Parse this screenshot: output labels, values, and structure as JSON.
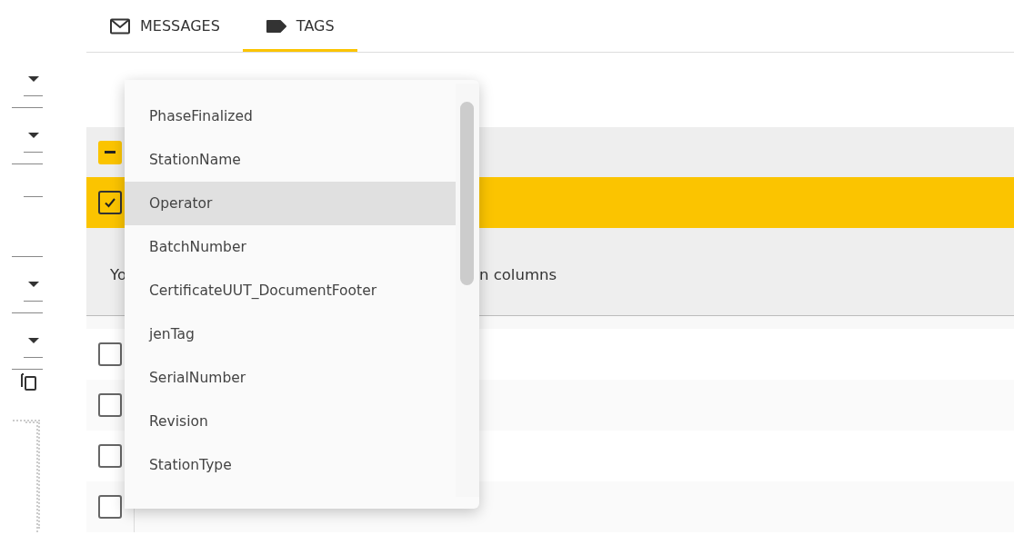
{
  "sidebar": {
    "controls": [
      {
        "kind": "dropdown"
      },
      {
        "kind": "dropdown"
      },
      {
        "kind": "field"
      },
      {
        "kind": "dropdown"
      },
      {
        "kind": "dropdown"
      },
      {
        "kind": "copy"
      },
      {
        "kind": "dotted"
      }
    ]
  },
  "tabs": [
    {
      "label": "MESSAGES",
      "kind": "mail",
      "selected": false
    },
    {
      "label": "TAGS",
      "kind": "tag",
      "selected": true
    }
  ],
  "table": {
    "header": {
      "indeterminate": true
    },
    "selected_row": {
      "checked": true,
      "selected": true
    },
    "info": {
      "text_start": "Yo",
      "text_end": "n columns"
    },
    "rows": [
      {
        "checked": false
      },
      {
        "checked": false
      },
      {
        "checked": false
      },
      {
        "checked": false
      }
    ]
  },
  "menu": {
    "items": [
      {
        "label": "PhaseFinalized",
        "selected": false
      },
      {
        "label": "StationName",
        "selected": false
      },
      {
        "label": "Operator",
        "selected": true
      },
      {
        "label": "BatchNumber",
        "selected": false
      },
      {
        "label": "CertificateUUT_DocumentFooter",
        "selected": false
      },
      {
        "label": "jenTag",
        "selected": false
      },
      {
        "label": "SerialNumber",
        "selected": false
      },
      {
        "label": "Revision",
        "selected": false
      },
      {
        "label": "StationType",
        "selected": false
      }
    ]
  }
}
